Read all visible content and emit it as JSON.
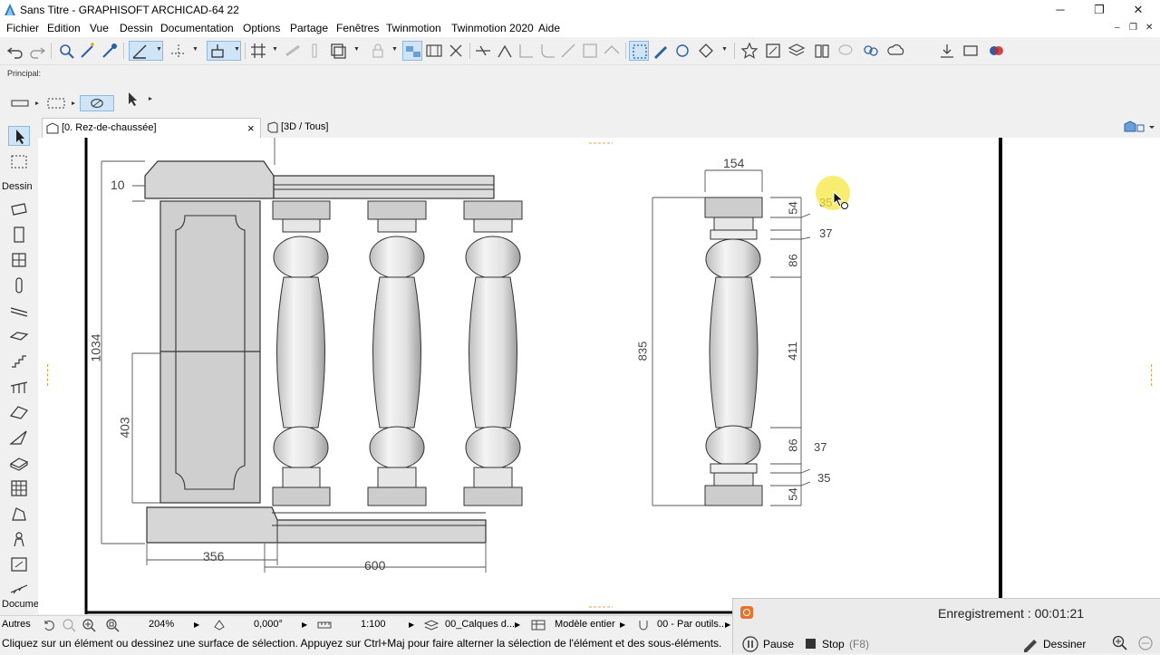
{
  "window": {
    "title": "Sans Titre - GRAPHISOFT ARCHICAD-64 22",
    "minimize": "─",
    "restore": "❐",
    "close": "✕"
  },
  "menu": {
    "items": [
      "Fichier",
      "Edition",
      "Vue",
      "Dessin",
      "Documentation",
      "Options",
      "Partage",
      "Fenêtres",
      "Twinmotion",
      "Twinmotion 2020",
      "Aide"
    ],
    "mdi_min": "–",
    "mdi_restore": "❐",
    "mdi_close": "✕"
  },
  "infobox": {
    "label": "Principal:"
  },
  "tabs": {
    "plan": "[0. Rez-de-chaussée]",
    "plan_close": "×",
    "view3d": "[3D / Tous]"
  },
  "toolbox": {
    "section_dessin": "Dessin",
    "section_docume": "Docume",
    "section_autres": "Autres"
  },
  "drawing": {
    "dims_left": {
      "d10": "10",
      "d1034": "1034",
      "d403": "403",
      "d356": "356",
      "d600": "600"
    },
    "dims_right": {
      "d154": "154",
      "d54_top": "54",
      "d35_top": "35",
      "d37_top": "37",
      "d86_top": "86",
      "d835": "835",
      "d411": "411",
      "d86_bot": "86",
      "d37_bot": "37",
      "d35_bot": "35",
      "d54_bot": "54"
    }
  },
  "navbar": {
    "zoom": "204%",
    "angle": "0,000°",
    "scale": "1:100",
    "layers": "00_Calques d...",
    "model": "Modèle entier",
    "pen": "00 - Par outils..."
  },
  "status": {
    "message": "Cliquez sur un élément ou dessinez une surface de sélection. Appuyez sur Ctrl+Maj pour faire alterner la sélection de l'élément et des sous-éléments."
  },
  "recorder": {
    "recording": "Enregistrement : 00:01:21",
    "pause": "Pause",
    "stop": "Stop",
    "stop_key": "(F8)",
    "draw": "Dessiner"
  },
  "colors": {
    "accent": "#cfe4f7",
    "record": "#e8722a",
    "cursor_highlight": "#f5e642"
  }
}
